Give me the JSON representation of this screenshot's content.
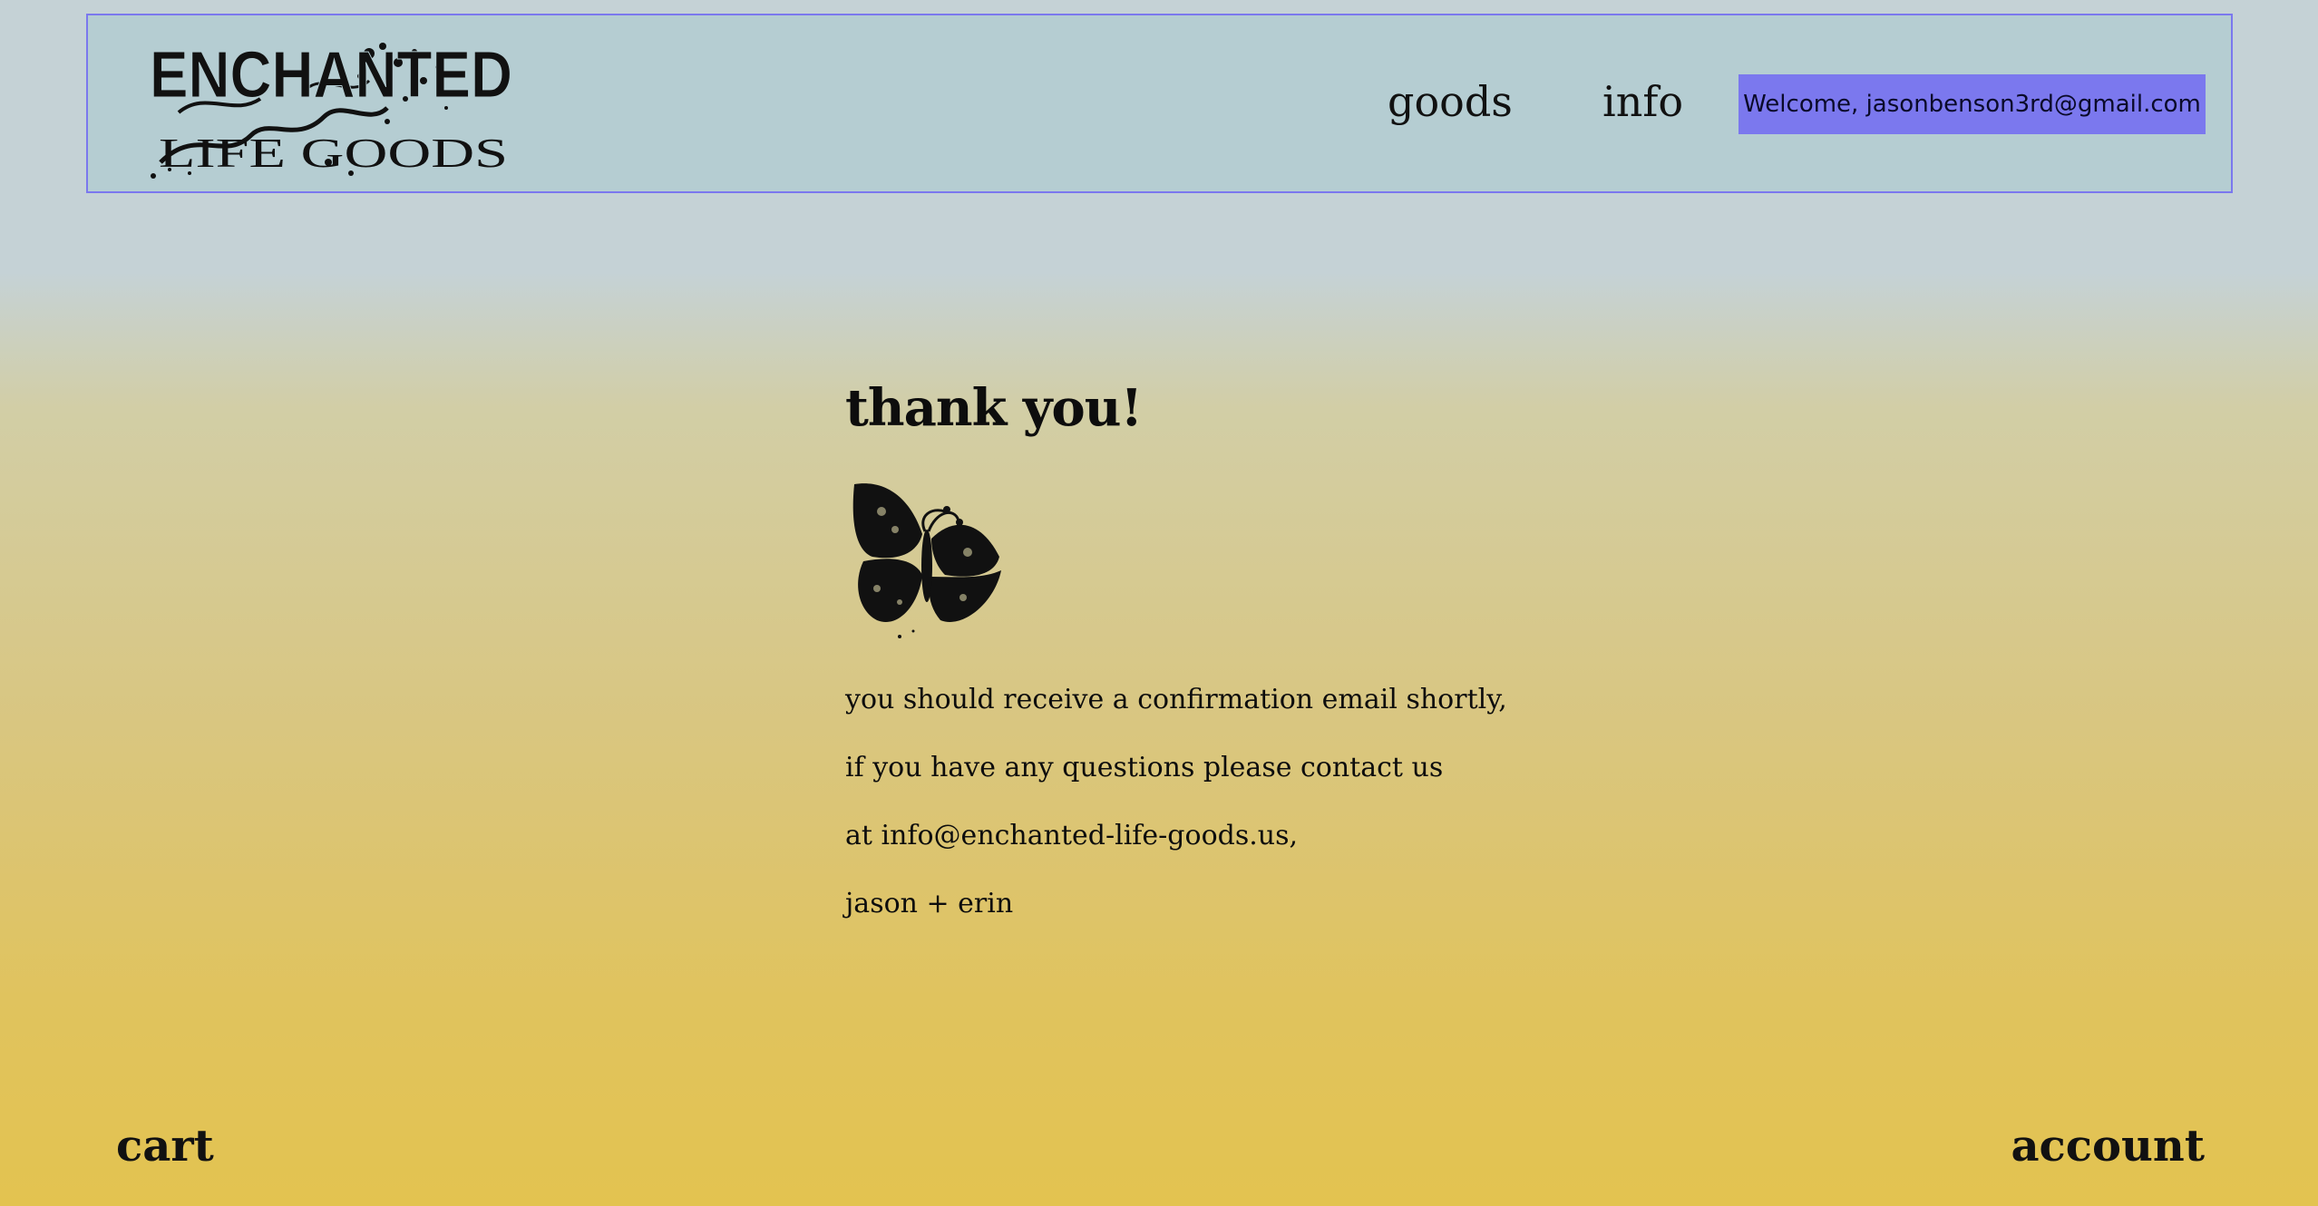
{
  "header": {
    "logo": {
      "icon": "enchanted-life-goods-logo",
      "line1": "ENCHANTED",
      "line2": "LIFE GOODS"
    },
    "nav": [
      {
        "label": "goods"
      },
      {
        "label": "info"
      }
    ],
    "welcome_text": "Welcome, jasonbenson3rd@gmail.com"
  },
  "main": {
    "title": "thank you!",
    "image_icon": "butterfly-icon",
    "messages": [
      "you should receive a confirmation email shortly,",
      "if you have any questions please contact us",
      "at info@enchanted-life-goods.us,",
      "jason + erin"
    ]
  },
  "footer": {
    "cart_label": "cart",
    "account_label": "account"
  },
  "colors": {
    "header_bg": "#b5cdd2",
    "header_border": "#7b78ee",
    "welcome_bg": "#7b78ee",
    "gradient_top": "#c5d2d6",
    "gradient_bottom": "#e3c350"
  }
}
